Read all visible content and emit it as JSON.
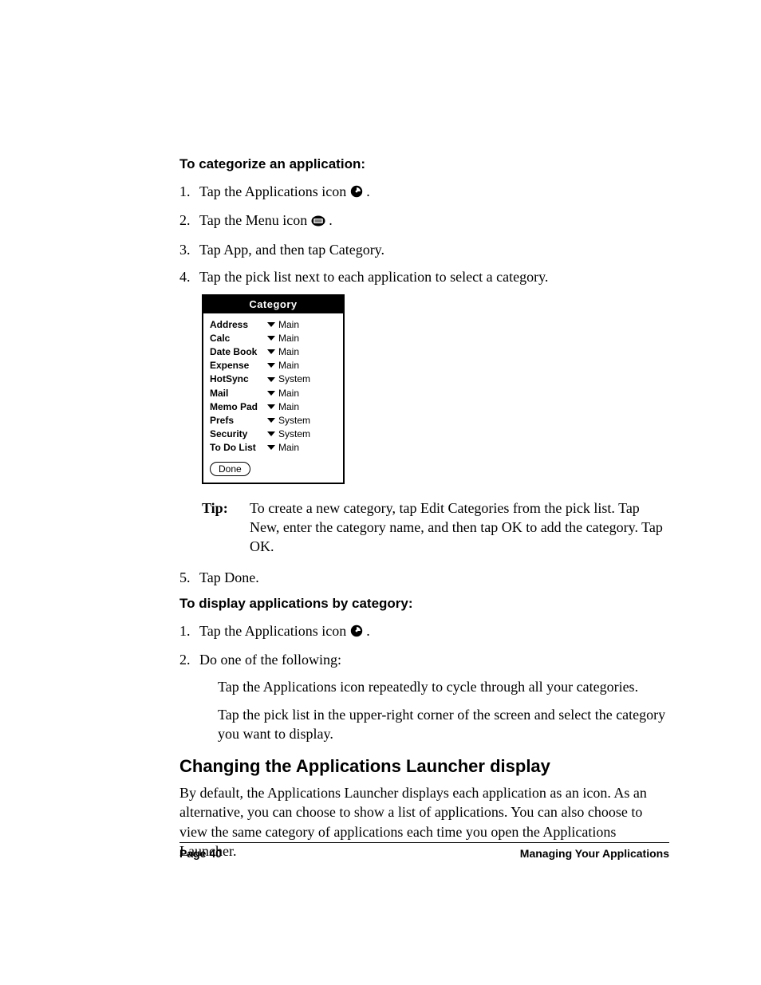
{
  "proc1": {
    "title": "To categorize an application:",
    "s1a": "Tap the Applications icon ",
    "s1b": ".",
    "s2a": "Tap the Menu icon ",
    "s2b": ".",
    "s3": "Tap App, and then tap Category.",
    "s4": "Tap the pick list next to each application to select a category.",
    "s5": "Tap Done."
  },
  "palm": {
    "title": "Category",
    "rows": [
      {
        "app": "Address",
        "cat": "Main"
      },
      {
        "app": "Calc",
        "cat": "Main"
      },
      {
        "app": "Date Book",
        "cat": "Main"
      },
      {
        "app": "Expense",
        "cat": "Main"
      },
      {
        "app": "HotSync",
        "cat": "System"
      },
      {
        "app": "Mail",
        "cat": "Main"
      },
      {
        "app": "Memo Pad",
        "cat": "Main"
      },
      {
        "app": "Prefs",
        "cat": "System"
      },
      {
        "app": "Security",
        "cat": "System"
      },
      {
        "app": "To Do List",
        "cat": "Main"
      }
    ],
    "done": "Done"
  },
  "tip": {
    "label": "Tip:",
    "text": "To create a new category, tap Edit Categories from the pick list. Tap New, enter the category name, and then tap OK to add the category. Tap OK."
  },
  "proc2": {
    "title": "To display applications by category:",
    "s1a": "Tap the Applications icon ",
    "s1b": ".",
    "s2": "Do one of the following:",
    "sub1": "Tap the Applications icon repeatedly to cycle through all your categories.",
    "sub2": "Tap the pick list in the upper-right corner of the screen and select the category you want to display."
  },
  "section": {
    "h2": "Changing the Applications Launcher display",
    "p": "By default, the Applications Launcher displays each application as an icon. As an alternative, you can choose to show a list of applications. You can also choose to view the same category of applications each time you open the Applications Launcher."
  },
  "footer": {
    "left": "Page 40",
    "right": "Managing Your Applications"
  }
}
